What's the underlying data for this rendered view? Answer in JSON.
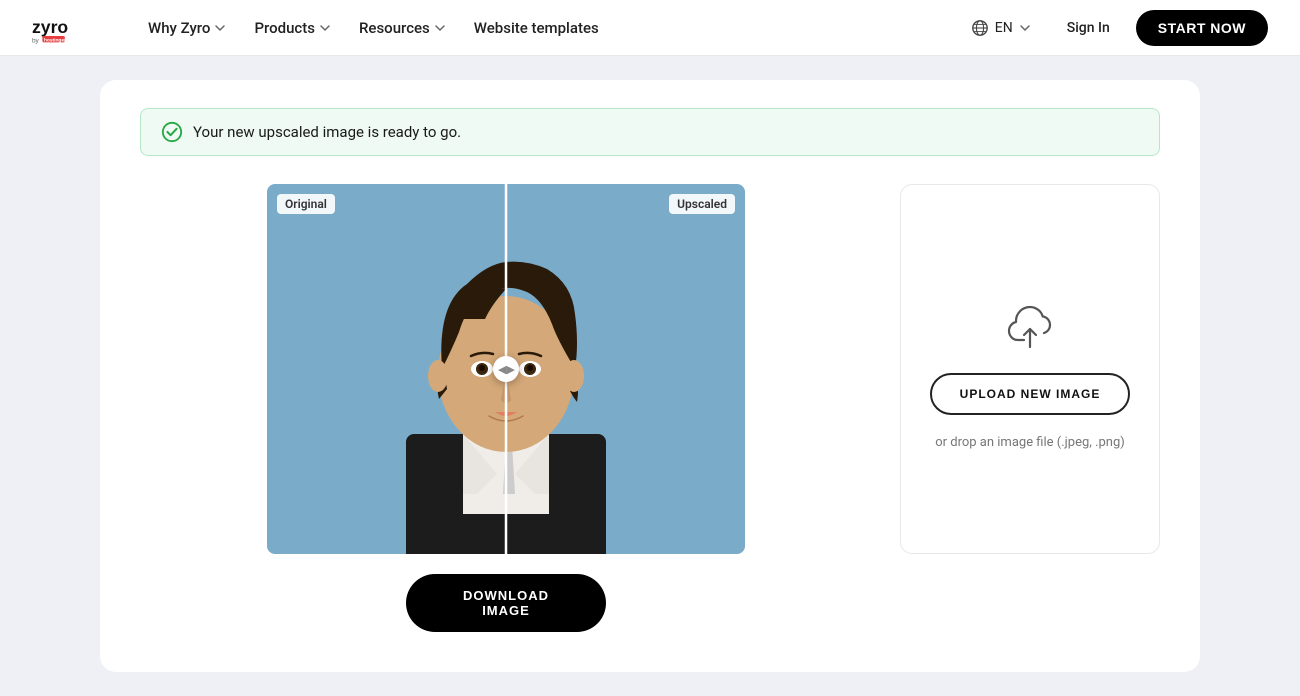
{
  "navbar": {
    "logo_alt": "Zyro by Hostinger",
    "nav_items": [
      {
        "label": "Why Zyro",
        "has_dropdown": true
      },
      {
        "label": "Products",
        "has_dropdown": true
      },
      {
        "label": "Resources",
        "has_dropdown": true
      },
      {
        "label": "Website templates",
        "has_dropdown": false
      }
    ],
    "lang": "EN",
    "sign_in": "Sign In",
    "start_now": "START NOW"
  },
  "success": {
    "message": "Your new upscaled image is ready to go."
  },
  "image_compare": {
    "original_label": "Original",
    "upscaled_label": "Upscaled"
  },
  "upload_panel": {
    "upload_btn_label": "UPLOAD NEW IMAGE",
    "drop_hint": "or drop an image file (.jpeg, .png)"
  },
  "download": {
    "label": "DOWNLOAD IMAGE"
  }
}
